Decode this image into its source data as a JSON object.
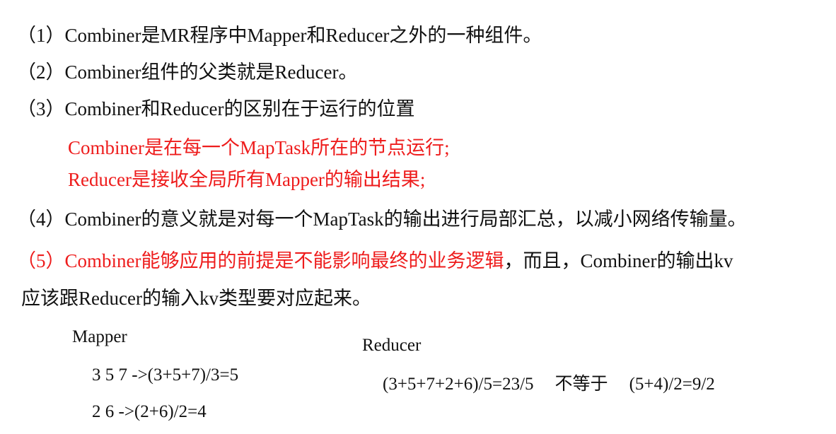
{
  "points": {
    "p1": "（1）Combiner是MR程序中Mapper和Reducer之外的一种组件。",
    "p2": "（2）Combiner组件的父类就是Reducer。",
    "p3": "（3）Combiner和Reducer的区别在于运行的位置",
    "p3_sub1": "Combiner是在每一个MapTask所在的节点运行;",
    "p3_sub2": "Reducer是接收全局所有Mapper的输出结果;",
    "p4": "（4）Combiner的意义就是对每一个MapTask的输出进行局部汇总，以减小网络传输量。",
    "p5_highlight": "（5）Combiner能够应用的前提是不能影响最终的业务逻辑",
    "p5_rest": "，而且，Combiner的输出kv",
    "p5_cont": "应该跟Reducer的输入kv类型要对应起来。"
  },
  "example": {
    "mapper_title": "Mapper",
    "mapper_line1": "3 5 7 ->(3+5+7)/3=5",
    "mapper_line2": "2 6 ->(2+6)/2=4",
    "reducer_title": "Reducer",
    "reducer_expr": "(3+5+7+2+6)/5=23/5",
    "not_equal": "不等于",
    "alt_expr": "(5+4)/2=9/2"
  },
  "colors": {
    "text": "#111111",
    "highlight": "#ee1c1c",
    "background": "#ffffff"
  }
}
